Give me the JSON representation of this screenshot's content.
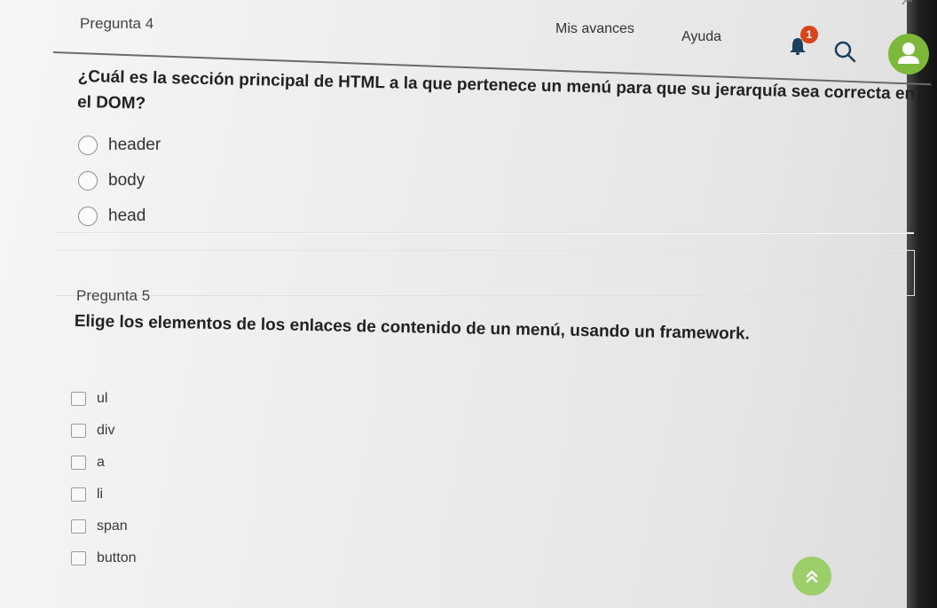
{
  "header": {
    "progress_label": "Mis avances",
    "help_label": "Ayuda",
    "notification_count": "1",
    "avatar_color": "#7db83a",
    "badge_color": "#d9431b"
  },
  "question4": {
    "label": "Pregunta 4",
    "text": "¿Cuál es la sección principal de HTML a la que pertenece un menú para que su jerarquía sea correcta en el DOM?",
    "options": [
      "header",
      "body",
      "head"
    ]
  },
  "question5": {
    "label": "Pregunta 5",
    "text": "Elige los elementos de los enlaces de contenido de un menú, usando un framework.",
    "options": [
      "ul",
      "div",
      "a",
      "li",
      "span",
      "button"
    ]
  },
  "scroll_top": {
    "icon": "double-chevron-up-icon",
    "glyph": "»"
  }
}
